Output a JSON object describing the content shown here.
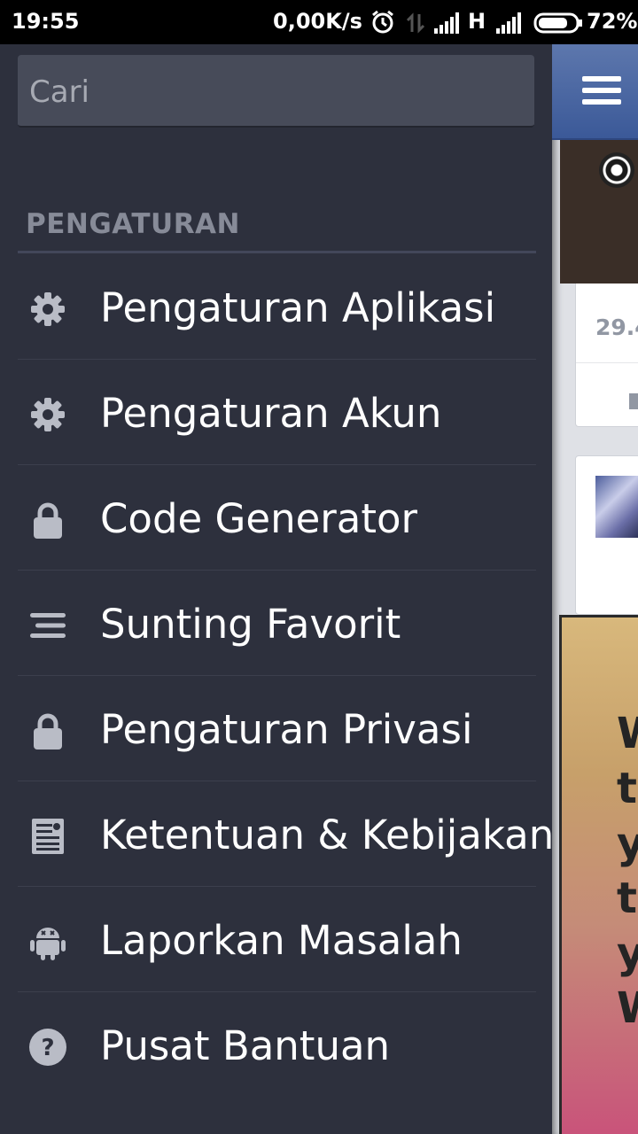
{
  "status_bar": {
    "time": "19:55",
    "net_speed": "0,00K/s",
    "network_type": "H",
    "battery_percent": "72%",
    "icons": [
      "alarm-icon",
      "data-transfer-icon",
      "signal-icon",
      "signal-icon",
      "battery-icon"
    ]
  },
  "drawer": {
    "search_placeholder": "Cari",
    "section_title": "PENGATURAN",
    "items": [
      {
        "label": "Pengaturan Aplikasi",
        "icon": "gear-icon"
      },
      {
        "label": "Pengaturan Akun",
        "icon": "gear-icon"
      },
      {
        "label": "Code Generator",
        "icon": "lock-icon"
      },
      {
        "label": "Sunting Favorit",
        "icon": "list-lines-icon"
      },
      {
        "label": "Pengaturan Privasi",
        "icon": "lock-icon"
      },
      {
        "label": "Ketentuan & Kebijakan",
        "icon": "document-icon"
      },
      {
        "label": "Laporkan Masalah",
        "icon": "android-icon"
      },
      {
        "label": "Pusat Bantuan",
        "icon": "help-icon"
      }
    ]
  },
  "main_peek": {
    "likes_fragment": "29.4",
    "poster_letters": "W\nt\ny\nt\ny\nW"
  },
  "colors": {
    "drawer_bg": "#2d303d",
    "header_blue": "#3b5998",
    "section_title": "#878b98"
  }
}
